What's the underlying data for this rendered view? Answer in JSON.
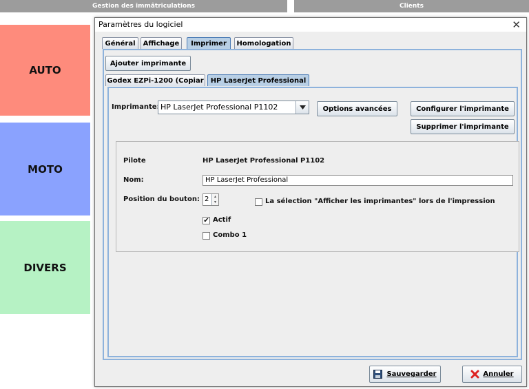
{
  "background": {
    "tabs": [
      "Gestion des immâtriculations",
      "Clients"
    ],
    "categories": [
      "AUTO",
      "MOTO",
      "DIVERS"
    ]
  },
  "dialog": {
    "title": "Paramètres du logiciel",
    "main_tabs": [
      "Général",
      "Affichage",
      "Imprimer",
      "Homologation"
    ],
    "selected_main_tab": "Imprimer",
    "add_printer_label": "Ajouter imprimante",
    "printer_tabs": [
      "Godex EZPi-1200 (Copiar",
      "HP LaserJet Professional"
    ],
    "selected_printer_tab": "HP LaserJet Professional",
    "printer_label": "Imprimante:",
    "printer_selected": "HP LaserJet Professional P1102",
    "advanced_options_label": "Options avancées",
    "configure_label": "Configurer l'imprimante",
    "delete_label": "Supprimer l'imprimante",
    "details": {
      "driver_label": "Pilote",
      "driver_value": "HP LaserJet Professional P1102",
      "name_label": "Nom:",
      "name_value": "HP LaserJet Professional",
      "position_label": "Position du bouton:",
      "position_value": "2",
      "show_printers_label": "La sélection \"Afficher les imprimantes\" lors de l'impression",
      "show_printers_checked": false,
      "active_label": "Actif",
      "active_checked": true,
      "combo_label": "Combo 1",
      "combo_checked": false
    },
    "save_label": "Sauvegarder",
    "cancel_label": "Annuler"
  }
}
